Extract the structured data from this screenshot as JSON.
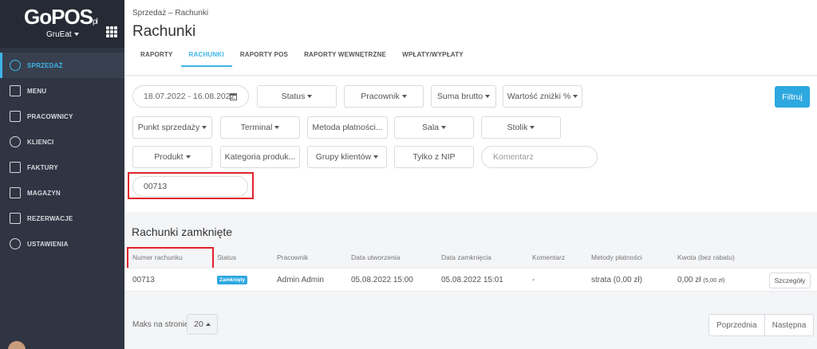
{
  "brand": {
    "logo": "GoPOS",
    "logo_suffix": "pl",
    "org_name": "GruEat"
  },
  "sidebar": {
    "items": [
      {
        "label": "SPRZEDAŻ",
        "icon": "pie-chart-icon",
        "active": true
      },
      {
        "label": "MENU",
        "icon": "menu-book-icon"
      },
      {
        "label": "PRACOWNICY",
        "icon": "employees-icon"
      },
      {
        "label": "KLIENCI",
        "icon": "clients-icon"
      },
      {
        "label": "FAKTURY",
        "icon": "invoice-icon"
      },
      {
        "label": "MAGAZYN",
        "icon": "warehouse-icon"
      },
      {
        "label": "REZERWACJE",
        "icon": "reservations-icon"
      },
      {
        "label": "USTAWIENIA",
        "icon": "settings-gear-icon"
      }
    ]
  },
  "header": {
    "breadcrumb": {
      "parent": "Sprzedaż",
      "separator": "–",
      "current": "Rachunki"
    },
    "title": "Rachunki",
    "tabs": [
      {
        "label": "RAPORTY"
      },
      {
        "label": "RACHUNKI",
        "active": true
      },
      {
        "label": "RAPORTY POS"
      },
      {
        "label": "RAPORTY WEWNĘTRZNE"
      },
      {
        "label": "WPŁATY/WYPŁATY"
      }
    ]
  },
  "filters": {
    "date_range": "18.07.2022 - 16.08.2022",
    "status": "Status",
    "employee": "Pracownik",
    "gross_sum": "Suma brutto",
    "discount_value": "Wartość zniżki %",
    "point_of_sale": "Punkt sprzedaży",
    "terminal": "Terminal",
    "payment_method": "Metoda płatności...",
    "room": "Sala",
    "table": "Stolik",
    "product": "Produkt",
    "product_category": "Kategoria produk...",
    "client_groups": "Grupy klientów",
    "nip_only": "Tylko z NIP",
    "comment_placeholder": "Komentarz",
    "search_value": "00713",
    "filter_button": "Filtruj"
  },
  "closed": {
    "title": "Rachunki zamknięte",
    "columns": [
      "Numer rachunku",
      "Status",
      "Pracownik",
      "Data utworzenia",
      "Data zamknięcia",
      "Komentarz",
      "Metody płatności",
      "Kwota (bez rabatu)"
    ],
    "rows": [
      {
        "number": "00713",
        "status": "Zamknięty",
        "employee": "Admin Admin",
        "created": "05.08.2022 15:00",
        "closed": "05.08.2022 15:01",
        "comment": "-",
        "payment": "strata (0,00 zł)",
        "amount": "0,00 zł",
        "amount_sub": "(5,00 zł)",
        "details": "Szczegóły"
      }
    ]
  },
  "pagination": {
    "per_page_label": "Maks na stronie",
    "per_page": "20",
    "prev": "Poprzednia",
    "next": "Następna"
  },
  "colors": {
    "accent": "#2ea8e0",
    "sidebar": "#2f3542",
    "highlight": "#e0232a"
  }
}
